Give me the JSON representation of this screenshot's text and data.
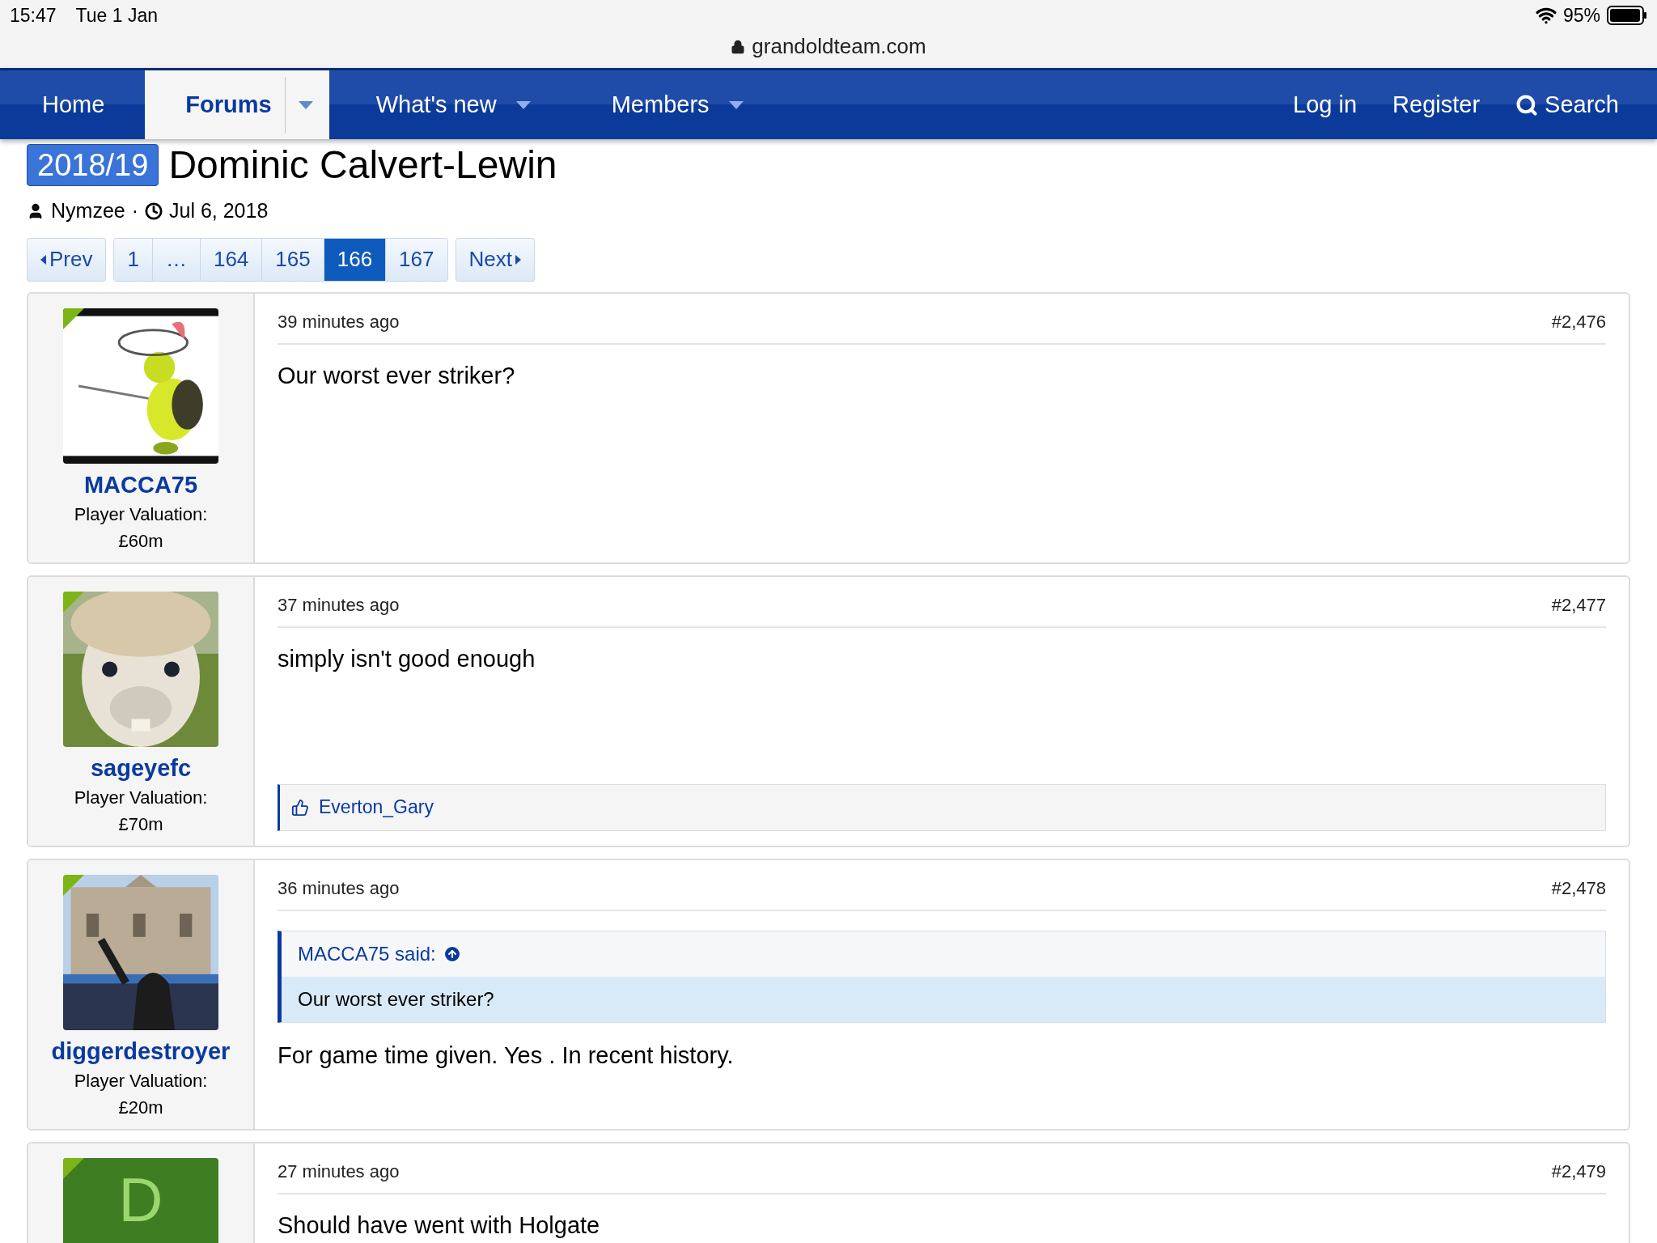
{
  "status_bar": {
    "time": "15:47",
    "date": "Tue 1 Jan",
    "battery": "95%"
  },
  "browser": {
    "url": "grandoldteam.com"
  },
  "nav": {
    "items": [
      {
        "label": "Home",
        "selected": false,
        "dropdown": false
      },
      {
        "label": "Forums",
        "selected": true,
        "dropdown": true
      },
      {
        "label": "What's new",
        "selected": false,
        "dropdown": true
      },
      {
        "label": "Members",
        "selected": false,
        "dropdown": true
      }
    ],
    "right": [
      "Log in",
      "Register"
    ],
    "search": "Search"
  },
  "thread": {
    "prefix": "2018/19",
    "title": "Dominic Calvert-Lewin",
    "author": "Nymzee",
    "separator": "·",
    "date": "Jul 6, 2018"
  },
  "pagination": {
    "prev": "Prev",
    "pages": [
      {
        "label": "1",
        "selected": false
      },
      {
        "label": "…",
        "selected": false
      },
      {
        "label": "164",
        "selected": false
      },
      {
        "label": "165",
        "selected": false
      },
      {
        "label": "166",
        "selected": true
      },
      {
        "label": "167",
        "selected": false
      }
    ],
    "next": "Next"
  },
  "posts": [
    {
      "author": "MACCA75",
      "valuation_label": "Player Valuation:",
      "valuation": "£60m",
      "time": "39 minutes ago",
      "number": "#2,476",
      "body": "Our worst ever striker?"
    },
    {
      "author": "sageyefc",
      "valuation_label": "Player Valuation:",
      "valuation": "£70m",
      "time": "37 minutes ago",
      "number": "#2,477",
      "body": "simply isn't good enough",
      "reaction": "Everton_Gary"
    },
    {
      "author": "diggerdestroyer",
      "valuation_label": "Player Valuation:",
      "valuation": "£20m",
      "time": "36 minutes ago",
      "number": "#2,478",
      "quote": {
        "source": "MACCA75 said:",
        "text": "Our worst ever striker?"
      },
      "body": "For game time given. Yes . In recent history."
    },
    {
      "avatar": {
        "kind": "letter",
        "letter": "D"
      },
      "time": "27 minutes ago",
      "number": "#2,479",
      "body": "Should have went with Holgate"
    }
  ]
}
